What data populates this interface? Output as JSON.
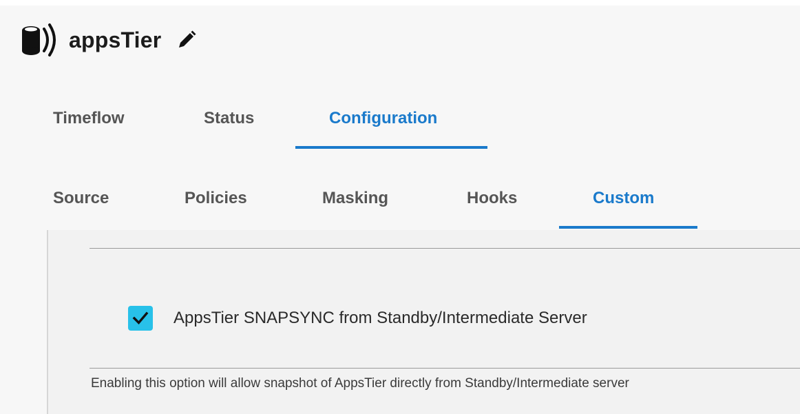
{
  "header": {
    "title": "appsTier",
    "db_icon": "database-icon",
    "edit_icon": "pencil-icon"
  },
  "primary_tabs": [
    {
      "label": "Timeflow",
      "active": false
    },
    {
      "label": "Status",
      "active": false
    },
    {
      "label": "Configuration",
      "active": true
    }
  ],
  "secondary_tabs": [
    {
      "label": "Source",
      "active": false
    },
    {
      "label": "Policies",
      "active": false
    },
    {
      "label": "Masking",
      "active": false
    },
    {
      "label": "Hooks",
      "active": false
    },
    {
      "label": "Custom",
      "active": true
    }
  ],
  "custom": {
    "snapsync_checkbox": {
      "label": "AppsTier SNAPSYNC from Standby/Intermediate Server",
      "checked": true
    },
    "help_text": "Enabling this option will allow snapshot of AppsTier directly from Standby/Intermediate server"
  },
  "colors": {
    "accent": "#1a7acb",
    "checkbox": "#28c1e9"
  }
}
